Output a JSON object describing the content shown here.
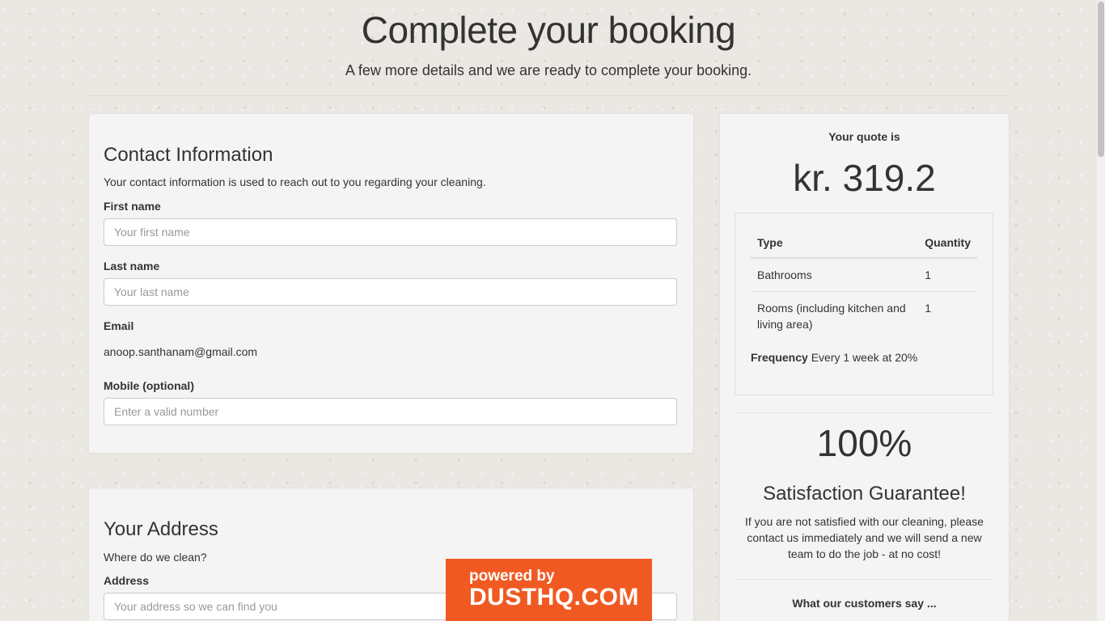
{
  "header": {
    "title": "Complete your booking",
    "subtitle": "A few more details and we are ready to complete your booking."
  },
  "contact": {
    "title": "Contact Information",
    "description": "Your contact information is used to reach out to you regarding your cleaning.",
    "first_name_label": "First name",
    "first_name_placeholder": "Your first name",
    "last_name_label": "Last name",
    "last_name_placeholder": "Your last name",
    "email_label": "Email",
    "email_value": "anoop.santhanam@gmail.com",
    "mobile_label": "Mobile (optional)",
    "mobile_placeholder": "Enter a valid number"
  },
  "address": {
    "title": "Your Address",
    "description": "Where do we clean?",
    "address_label": "Address",
    "address_placeholder": "Your address so we can find you"
  },
  "quote": {
    "label": "Your quote is",
    "price": "kr. 319.2",
    "table": {
      "headers": [
        "Type",
        "Quantity"
      ],
      "rows": [
        {
          "type": "Bathrooms",
          "quantity": "1"
        },
        {
          "type": "Rooms (including kitchen and living area)",
          "quantity": "1"
        }
      ]
    },
    "frequency_label": "Frequency",
    "frequency_value": "Every 1 week at 20%"
  },
  "guarantee": {
    "percent": "100%",
    "title": "Satisfaction Guarantee!",
    "text": "If you are not satisfied with our cleaning, please contact us immediately and we will send a new team to do the job - at no cost!"
  },
  "customers": {
    "title": "What our customers say ..."
  },
  "badge": {
    "small": "powered by",
    "big": "DUSTHQ.COM"
  },
  "colors": {
    "badge": "#f05a22",
    "card": "#f4f4f4",
    "background": "#ebe8e3"
  }
}
